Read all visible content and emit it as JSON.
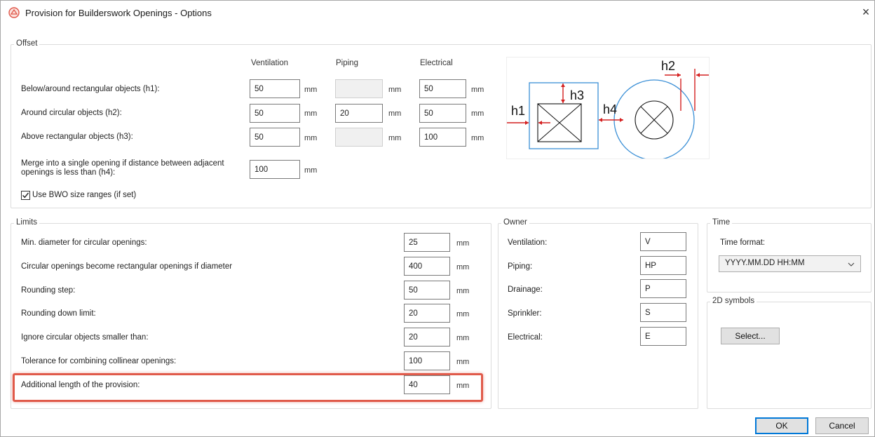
{
  "window": {
    "title": "Provision for Builderswork Openings - Options",
    "close_label": "×"
  },
  "offset": {
    "group_label": "Offset",
    "col_ventilation": "Ventilation",
    "col_piping": "Piping",
    "col_electrical": "Electrical",
    "unit": "mm",
    "rows": [
      {
        "label": "Below/around rectangular objects (h1):",
        "ventilation": "50",
        "piping": "",
        "electrical": "50",
        "piping_disabled": true
      },
      {
        "label": "Around circular objects (h2):",
        "ventilation": "50",
        "piping": "20",
        "electrical": "50",
        "piping_disabled": false
      },
      {
        "label": "Above rectangular objects (h3):",
        "ventilation": "50",
        "piping": "",
        "electrical": "100",
        "piping_disabled": true
      }
    ],
    "merge_label": "Merge into a single opening if distance between adjacent openings is less than (h4):",
    "merge_value": "100",
    "use_bwo_label": "Use BWO size ranges (if set)",
    "use_bwo_checked": true,
    "diagram": {
      "h1": "h1",
      "h2": "h2",
      "h3": "h3",
      "h4": "h4"
    }
  },
  "limits": {
    "group_label": "Limits",
    "unit": "mm",
    "rows": [
      {
        "label": "Min. diameter for circular openings:",
        "value": "25"
      },
      {
        "label": "Circular openings become rectangular openings if diameter",
        "value": "400"
      },
      {
        "label": "Rounding step:",
        "value": "50"
      },
      {
        "label": "Rounding down limit:",
        "value": "20"
      },
      {
        "label": "Ignore circular objects smaller than:",
        "value": "20"
      },
      {
        "label": "Tolerance for combining collinear openings:",
        "value": "100"
      },
      {
        "label": "Additional length of the provision:",
        "value": "40"
      }
    ]
  },
  "owner": {
    "group_label": "Owner",
    "rows": [
      {
        "label": "Ventilation:",
        "value": "V"
      },
      {
        "label": "Piping:",
        "value": "HP"
      },
      {
        "label": "Drainage:",
        "value": "P"
      },
      {
        "label": "Sprinkler:",
        "value": "S"
      },
      {
        "label": "Electrical:",
        "value": "E"
      }
    ]
  },
  "time": {
    "group_label": "Time",
    "format_label": "Time format:",
    "format_value": "YYYY.MM.DD HH:MM"
  },
  "symbols": {
    "group_label": "2D symbols",
    "select_button": "Select..."
  },
  "footer": {
    "ok_label": "OK",
    "cancel_label": "Cancel"
  },
  "colors": {
    "highlight": "#e05a4a",
    "diagram_blue": "#3a8fd6",
    "diagram_red": "#d42020"
  }
}
